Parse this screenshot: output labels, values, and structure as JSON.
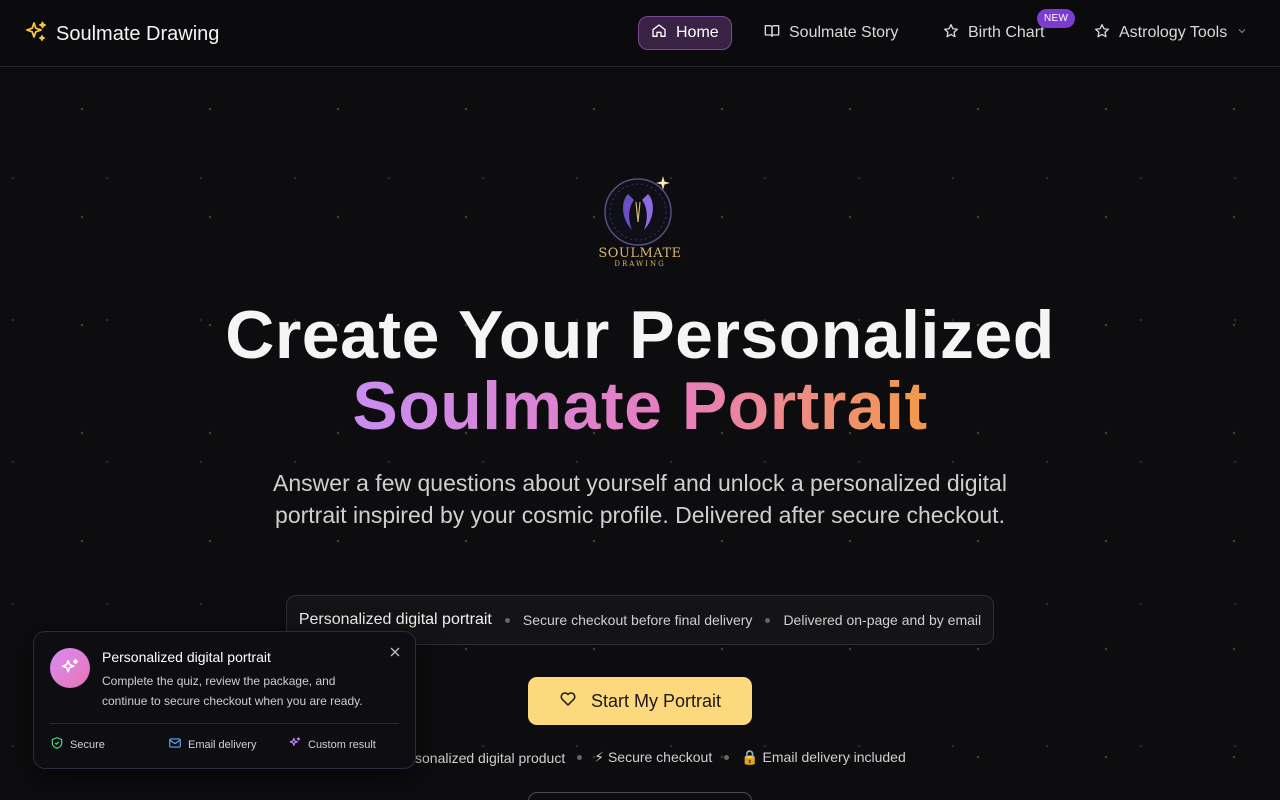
{
  "brand": {
    "title": "Soulmate Drawing",
    "icon": "sparkles-icon"
  },
  "nav": {
    "items": [
      {
        "label": "Home",
        "icon": "home-icon",
        "active": true
      },
      {
        "label": "Soulmate Story",
        "icon": "book-open-icon"
      },
      {
        "label": "Birth Chart",
        "icon": "star-icon",
        "badge": "NEW"
      },
      {
        "label": "Astrology Tools",
        "icon": "star-icon",
        "dropdown": true
      }
    ]
  },
  "hero": {
    "logo_word": "SOULMATE",
    "logo_sub": "DRAWING",
    "title_line1": "Create Your Personalized",
    "title_line2": "Soulmate Portrait",
    "subtitle": "Answer a few questions about yourself and unlock a personalized digital portrait inspired by your cosmic profile. Delivered after secure checkout.",
    "chips": [
      "Personalized digital portrait",
      "Secure checkout before final delivery",
      "Delivered on-page and by email"
    ],
    "cta_label": "Start My Portrait",
    "trust": [
      "sonalized digital product",
      "⚡ Secure checkout",
      "🔒 Email delivery included"
    ]
  },
  "toast": {
    "title": "Personalized digital portrait",
    "body": "Complete the quiz, review the package, and continue to secure checkout when you are ready.",
    "features": [
      "Secure",
      "Email delivery",
      "Custom result"
    ]
  },
  "colors": {
    "accent_gold": "#fcd97c",
    "gradient_start": "#c98df0",
    "gradient_end": "#f29a4a",
    "nav_active_bg": "#3a2146",
    "badge": "#7c3bd1"
  }
}
